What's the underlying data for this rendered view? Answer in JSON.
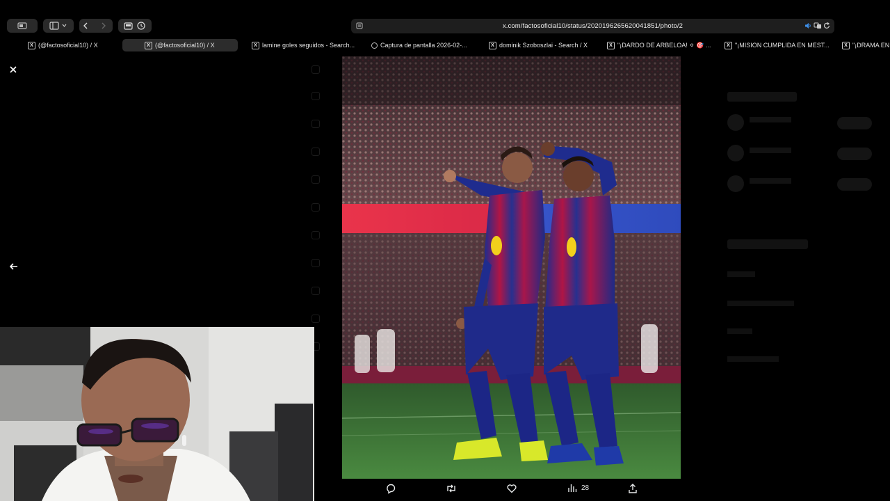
{
  "browser": {
    "url": "x.com/factosoficial10/status/2020196265620041851/photo/2",
    "tabs": [
      {
        "title": "(@factosoficial10) / X",
        "icon": "x-logo-icon",
        "active": false
      },
      {
        "title": "(@factosoficial10) / X",
        "icon": "x-logo-icon",
        "active": true
      },
      {
        "title": "lamine goles seguidos - Search...",
        "icon": "x-logo-icon",
        "active": false
      },
      {
        "title": "Captura de pantalla 2026-02-...",
        "icon": "circle-icon",
        "active": false
      },
      {
        "title": "dominik Szoboszlai - Search / X",
        "icon": "x-logo-icon",
        "active": false
      },
      {
        "title": "\"¡DARDO DE ARBELOA! ⚪ 🎯 ...",
        "icon": "x-logo-icon",
        "active": false
      },
      {
        "title": "\"¡MISION CUMPLIDA EN MEST...",
        "icon": "x-logo-icon",
        "active": false
      },
      {
        "title": "\"¡DRAMA EN ...",
        "icon": "x-logo-icon",
        "active": false
      }
    ]
  },
  "lightbox": {
    "close_icon": "close-icon",
    "prev_icon": "arrow-left-icon",
    "actions": {
      "reply_icon": "reply-icon",
      "repost_icon": "repost-icon",
      "like_icon": "heart-icon",
      "views_icon": "views-chart-icon",
      "views_count": "28",
      "share_icon": "share-icon"
    }
  },
  "colors": {
    "background": "#000000",
    "jersey_blue": "#1c2a8c",
    "jersey_red": "#b3123f",
    "pitch_green": "#3f7f3a",
    "boot_yellow": "#d8e82a"
  }
}
